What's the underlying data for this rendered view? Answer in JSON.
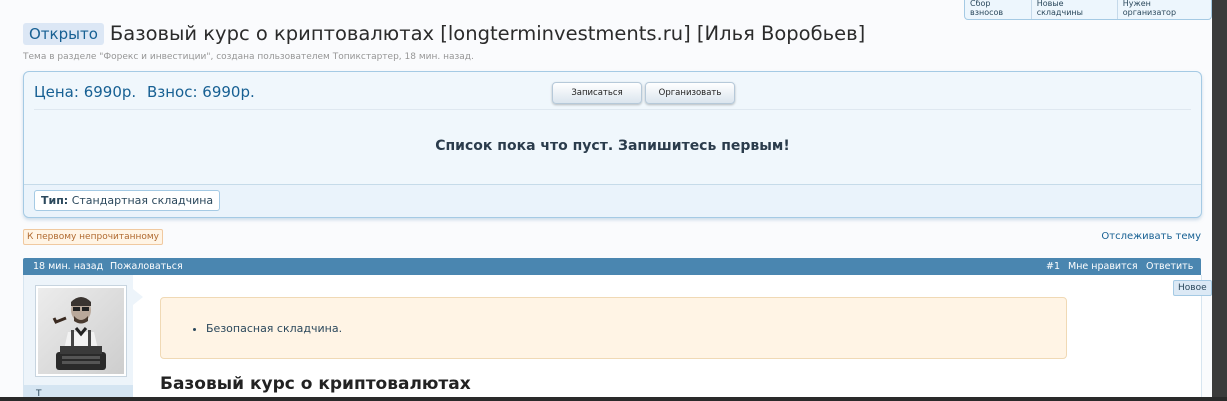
{
  "top_tabs": [
    "Сбор взносов",
    "Новые складчины",
    "Нужен организатор"
  ],
  "thread": {
    "status": "Открыто",
    "title": "Базовый курс о криптовалютах [longterminvestments.ru] [Илья Воробьев]",
    "meta": "Тема в разделе \"Форекс и инвестиции\", создана пользователем Топикстартер, 18 мин. назад."
  },
  "pricebox": {
    "price": "Цена: 6990р.",
    "fee": "Взнос: 6990р.",
    "join_label": "Записаться",
    "organize_label": "Организовать",
    "empty_message": "Список пока что пуст. Запишитесь первым!",
    "type_label": "Тип:",
    "type_value": "Стандартная складчина"
  },
  "nav": {
    "first_unread": "К первому непрочитанному",
    "watch": "Отслеживать тему"
  },
  "post": {
    "time": "18 мин. назад",
    "report": "Пожаловаться",
    "number": "#1",
    "like": "Мне нравится",
    "reply": "Ответить",
    "notice_item": "Безопасная складчина.",
    "heading": "Базовый курс о криптовалютах",
    "user_initial": "Т"
  },
  "new_badge": "Новое",
  "colors": {
    "accent": "#176093",
    "post_bar": "#4a86b0",
    "notice_bg": "#fff4e5"
  }
}
